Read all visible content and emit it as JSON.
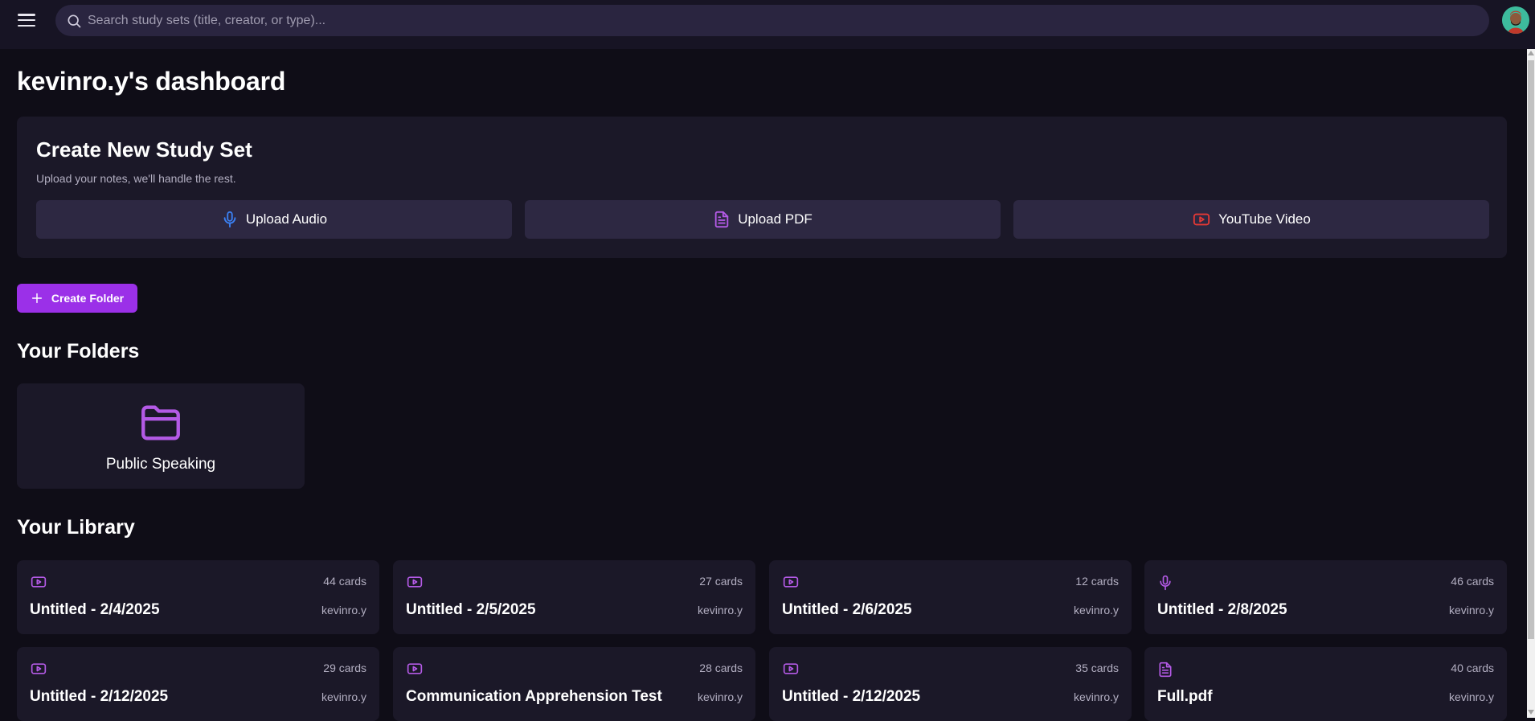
{
  "search": {
    "placeholder": "Search study sets (title, creator, or type)..."
  },
  "page_title": "kevinro.y's dashboard",
  "create": {
    "title": "Create New Study Set",
    "subtitle": "Upload your notes, we'll handle the rest.",
    "buttons": [
      {
        "label": "Upload Audio",
        "icon": "microphone-icon"
      },
      {
        "label": "Upload PDF",
        "icon": "file-icon"
      },
      {
        "label": "YouTube Video",
        "icon": "youtube-icon"
      }
    ]
  },
  "create_folder_label": "Create Folder",
  "folders": {
    "title": "Your Folders",
    "items": [
      {
        "name": "Public Speaking",
        "icon": "folder-icon"
      }
    ]
  },
  "library": {
    "title": "Your Library",
    "items": [
      {
        "title": "Untitled - 2/4/2025",
        "count": "44 cards",
        "creator": "kevinro.y",
        "type": "video"
      },
      {
        "title": "Untitled - 2/5/2025",
        "count": "27 cards",
        "creator": "kevinro.y",
        "type": "video"
      },
      {
        "title": "Untitled - 2/6/2025",
        "count": "12 cards",
        "creator": "kevinro.y",
        "type": "video"
      },
      {
        "title": "Untitled - 2/8/2025",
        "count": "46 cards",
        "creator": "kevinro.y",
        "type": "audio"
      },
      {
        "title": "Untitled - 2/12/2025",
        "count": "29 cards",
        "creator": "kevinro.y",
        "type": "video"
      },
      {
        "title": "Communication Apprehension Test",
        "count": "28 cards",
        "creator": "kevinro.y",
        "type": "video"
      },
      {
        "title": "Untitled - 2/12/2025",
        "count": "35 cards",
        "creator": "kevinro.y",
        "type": "video"
      },
      {
        "title": "Full.pdf",
        "count": "40 cards",
        "creator": "kevinro.y",
        "type": "pdf"
      }
    ]
  },
  "colors": {
    "accent": "#9b30e8",
    "icon_purple": "#b45ae6",
    "mic_blue": "#3b82f6",
    "youtube_red": "#e53935",
    "background": "#0f0d17",
    "card": "#1b1828"
  }
}
